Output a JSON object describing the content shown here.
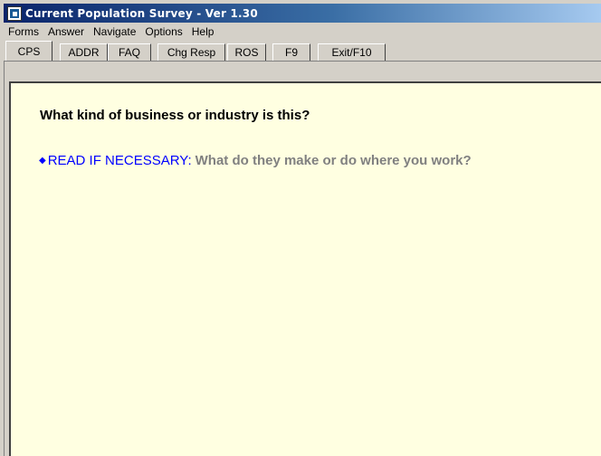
{
  "window": {
    "title": "Current Population Survey - Ver 1.30"
  },
  "menu": [
    "Forms",
    "Answer",
    "Navigate",
    "Options",
    "Help"
  ],
  "tabs": [
    "CPS",
    "ADDR",
    "FAQ",
    "Chg Resp",
    "ROS",
    "F9",
    "Exit/F10"
  ],
  "question": {
    "text": "What kind of business or industry is this?",
    "instruction_bullet": "◆",
    "instruction_label": "READ IF NECESSARY:",
    "instruction_probe": "What do they make or do where you work?"
  },
  "colors": {
    "content_background": "#ffffe1",
    "instruction_blue": "#0000ff",
    "probe_gray": "#808080",
    "titlebar_start": "#0a246a"
  }
}
